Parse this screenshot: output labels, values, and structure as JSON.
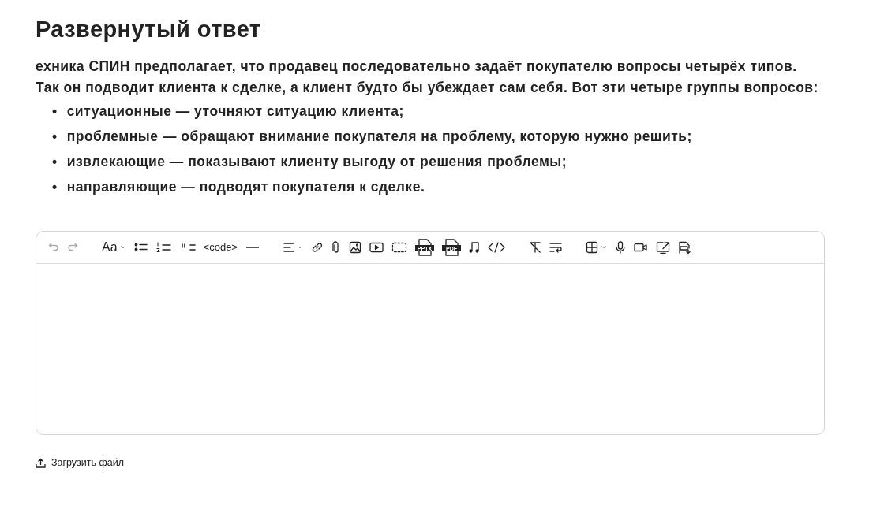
{
  "title": "Развернутый ответ",
  "intro": "ехника СПИН предполагает, что продавец последовательно задаёт покупателю вопросы четырёх типов. Так он подводит клиента к сделке, а клиент будто бы убеждает сам себя. Вот эти четыре группы вопросов:",
  "bullets": [
    {
      "marker": "•",
      "text": "ситуационные — уточняют ситуацию клиента;"
    },
    {
      "marker": "•",
      "text": "проблемные — обращают внимание покупателя на проблему, которую нужно решить;"
    },
    {
      "marker": "•",
      "text": "извлекающие — показывают клиенту выгоду от решения проблемы;"
    },
    {
      "marker": "•",
      "text": "направляющие — подводят покупателя к сделке."
    }
  ],
  "toolbar": {
    "undo": {
      "disabled": true
    },
    "redo": {
      "disabled": true
    },
    "font_button": "Aa",
    "code_button": "<code>",
    "pptx_label": "PPTX",
    "pdf_label": "PDF"
  },
  "upload_link": "Загрузить файл"
}
